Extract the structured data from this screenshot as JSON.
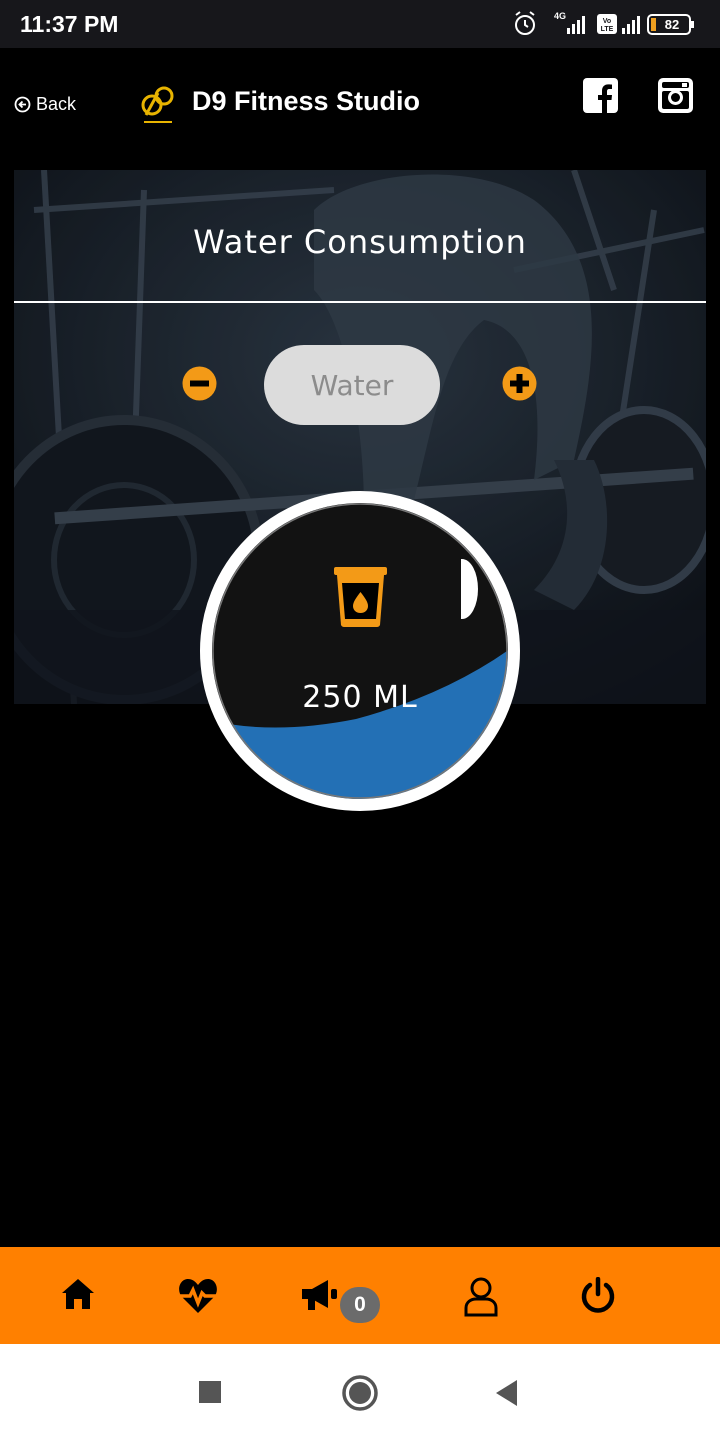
{
  "status_bar": {
    "time": "11:37 PM",
    "network_label": "4G",
    "volte_label": "Vo LTE",
    "battery": "82"
  },
  "header": {
    "back_label": "Back",
    "title": "D9 Fitness Studio"
  },
  "main": {
    "section_title": "Water Consumption",
    "drink_type": "Water",
    "amount_label": "250 ML",
    "fill_level_percent": 35
  },
  "bottom_nav": {
    "items": [
      {
        "icon": "home-icon"
      },
      {
        "icon": "heart-pulse-icon"
      },
      {
        "icon": "megaphone-icon",
        "badge": "0"
      },
      {
        "icon": "user-icon"
      },
      {
        "icon": "power-icon"
      }
    ]
  },
  "colors": {
    "accent": "#ff8000",
    "water": "#2370b5",
    "icon_orange": "#f39a17"
  }
}
